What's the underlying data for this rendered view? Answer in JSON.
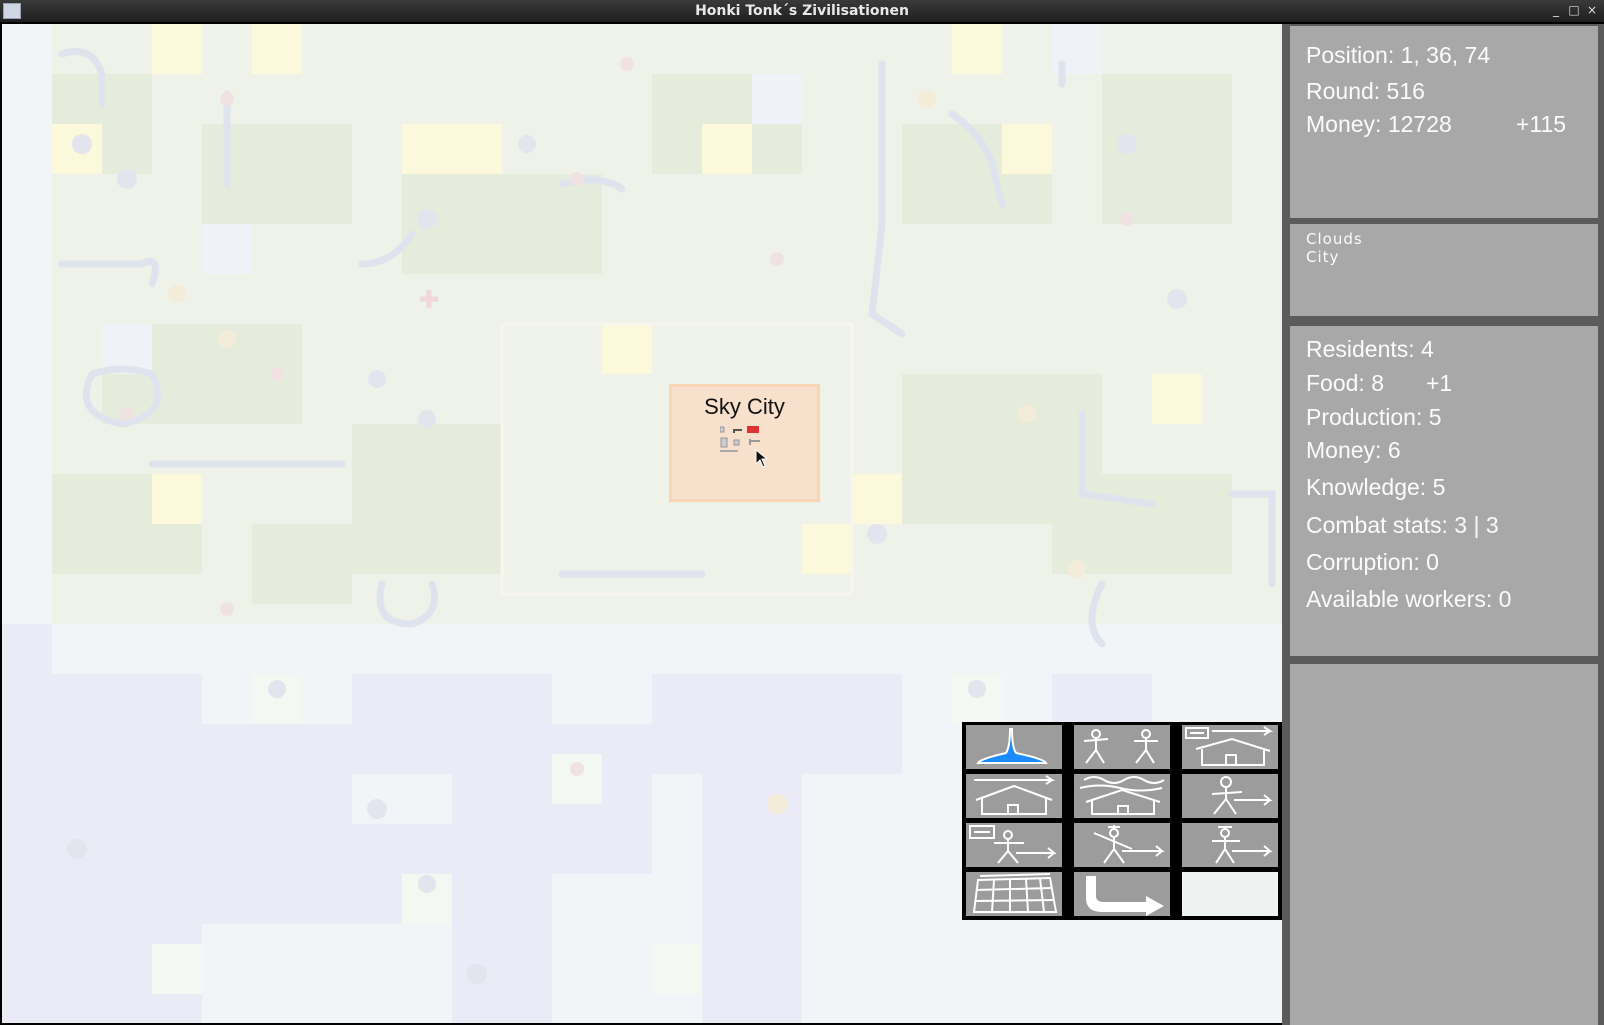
{
  "window": {
    "title": "Honki Tonk´s Zivilisationen",
    "buttons": [
      "_",
      "□",
      "×"
    ]
  },
  "city": {
    "name": "Sky City"
  },
  "status": {
    "position": "Position: 1, 36, 74",
    "round": "Round: 516",
    "money": "Money: 12728",
    "money_delta": "+115"
  },
  "tile_info": {
    "terrain": "Clouds",
    "feature": "City"
  },
  "city_stats": {
    "residents": "Residents: 4",
    "food": "Food: 8",
    "food_delta": "+1",
    "production": "Production: 5",
    "money": "Money: 6",
    "knowledge": "Knowledge: 5",
    "combat": "Combat stats: 3 | 3",
    "corruption": "Corruption: 0",
    "workers": "Available workers: 0"
  },
  "actions": [
    {
      "icon": "water-drop-icon"
    },
    {
      "icon": "two-workers-icon"
    },
    {
      "icon": "build-house-sign-icon"
    },
    {
      "icon": "house-arrow-icon"
    },
    {
      "icon": "house-upgrade-icon"
    },
    {
      "icon": "worker-arrow-icon"
    },
    {
      "icon": "worker-sign-arrow-icon"
    },
    {
      "icon": "soldier-arrow-icon"
    },
    {
      "icon": "settler-arrow-icon"
    },
    {
      "icon": "field-grid-icon"
    },
    {
      "icon": "turn-arrow-icon"
    },
    {
      "icon": "empty-slot"
    }
  ],
  "colors": {
    "sidebar_panel": "#a8a8a8",
    "sidebar_bg": "#5b5b5b",
    "city_fill": "#f7e0cc",
    "water_icon": "#1a8cff"
  }
}
